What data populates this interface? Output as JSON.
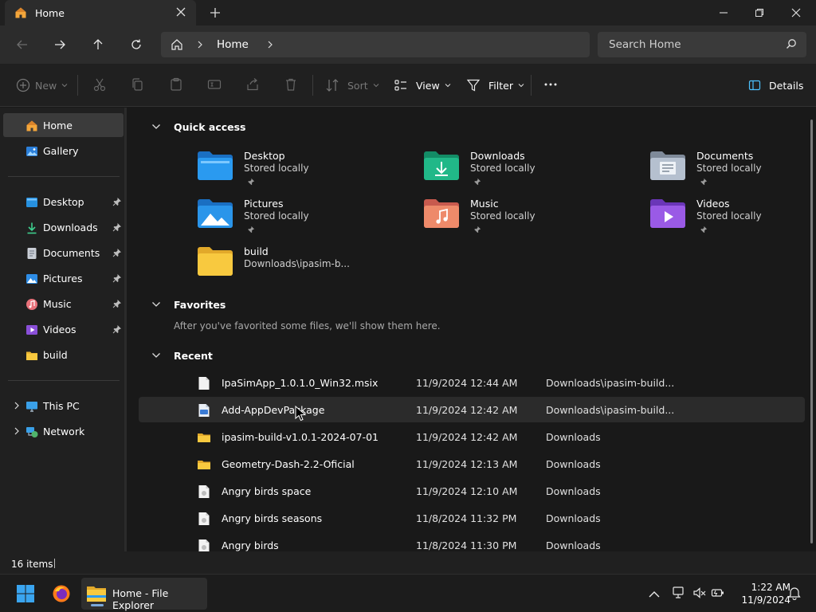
{
  "window": {
    "tab_title": "Home",
    "search_placeholder": "Search Home"
  },
  "address": {
    "crumb": "Home"
  },
  "commands": {
    "new": "New",
    "sort": "Sort",
    "view": "View",
    "filter": "Filter",
    "details": "Details"
  },
  "sidebar": {
    "items": [
      {
        "label": "Home",
        "icon": "home-icon"
      },
      {
        "label": "Gallery",
        "icon": "gallery-icon"
      },
      {
        "label": "Desktop",
        "icon": "desktop-icon"
      },
      {
        "label": "Downloads",
        "icon": "downloads-icon"
      },
      {
        "label": "Documents",
        "icon": "documents-icon"
      },
      {
        "label": "Pictures",
        "icon": "pictures-icon"
      },
      {
        "label": "Music",
        "icon": "music-icon"
      },
      {
        "label": "Videos",
        "icon": "videos-icon"
      },
      {
        "label": "build",
        "icon": "folder-icon"
      },
      {
        "label": "This PC",
        "icon": "this-pc-icon"
      },
      {
        "label": "Network",
        "icon": "network-icon"
      }
    ]
  },
  "sections": {
    "quick_access": "Quick access",
    "favorites": "Favorites",
    "favorites_note": "After you've favorited some files, we'll show them here.",
    "recent": "Recent"
  },
  "quick_access": [
    {
      "name": "Desktop",
      "sub": "Stored locally"
    },
    {
      "name": "Downloads",
      "sub": "Stored locally"
    },
    {
      "name": "Documents",
      "sub": "Stored locally"
    },
    {
      "name": "Pictures",
      "sub": "Stored locally"
    },
    {
      "name": "Music",
      "sub": "Stored locally"
    },
    {
      "name": "Videos",
      "sub": "Stored locally"
    },
    {
      "name": "build",
      "sub": "Downloads\\ipasim-b..."
    }
  ],
  "recent": [
    {
      "name": "IpaSimApp_1.0.1.0_Win32.msix",
      "date": "11/9/2024 12:44 AM",
      "location": "Downloads\\ipasim-build..."
    },
    {
      "name": "Add-AppDevPackage",
      "date": "11/9/2024 12:42 AM",
      "location": "Downloads\\ipasim-build..."
    },
    {
      "name": "ipasim-build-v1.0.1-2024-07-01",
      "date": "11/9/2024 12:42 AM",
      "location": "Downloads"
    },
    {
      "name": "Geometry-Dash-2.2-Oficial",
      "date": "11/9/2024 12:13 AM",
      "location": "Downloads"
    },
    {
      "name": "Angry birds space",
      "date": "11/9/2024 12:10 AM",
      "location": "Downloads"
    },
    {
      "name": "Angry birds seasons",
      "date": "11/8/2024 11:32 PM",
      "location": "Downloads"
    },
    {
      "name": "Angry birds",
      "date": "11/8/2024 11:30 PM",
      "location": "Downloads"
    }
  ],
  "status": {
    "items": "16 items"
  },
  "taskbar": {
    "app_label": "Home - File Explorer",
    "time": "1:22 AM",
    "date": "11/9/2024"
  },
  "colors": {
    "accent": "#4cc2ff",
    "folder_yellow": "#f8c93f",
    "selection": "#3b3b3b"
  }
}
